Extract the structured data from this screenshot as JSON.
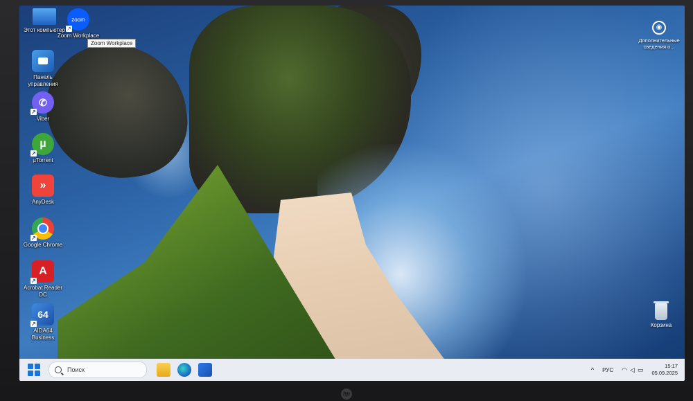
{
  "desktop": {
    "icons": [
      {
        "label": "Этот компьютер",
        "icon": "computer-icon"
      },
      {
        "label": "Zoom Workplace",
        "icon": "zoom-icon",
        "glyph": "zoom"
      },
      {
        "label": "Панель управления",
        "icon": "control-panel-icon"
      },
      {
        "label": "Viber",
        "icon": "viber-icon"
      },
      {
        "label": "µTorrent",
        "icon": "utorrent-icon",
        "glyph": "µ"
      },
      {
        "label": "AnyDesk",
        "icon": "anydesk-icon",
        "glyph": "»"
      },
      {
        "label": "Google Chrome",
        "icon": "chrome-icon"
      },
      {
        "label": "Acrobat Reader DC",
        "icon": "acrobat-icon",
        "glyph": "A"
      },
      {
        "label": "AIDA64 Business",
        "icon": "aida64-icon",
        "glyph": "64"
      }
    ],
    "tooltip": "Zoom Workplace",
    "info_widget": "Дополнительные сведения о...",
    "recycle_bin": "Корзина"
  },
  "taskbar": {
    "search_placeholder": "Поиск",
    "apps": [
      "file-explorer-icon",
      "edge-icon",
      "store-icon"
    ],
    "tray": {
      "chevron": "^",
      "language": "РУС",
      "time": "15:17",
      "date": "05.09.2025"
    }
  },
  "colors": {
    "taskbar_bg": "#e9edf3",
    "start_blue": "#1b74d8"
  }
}
